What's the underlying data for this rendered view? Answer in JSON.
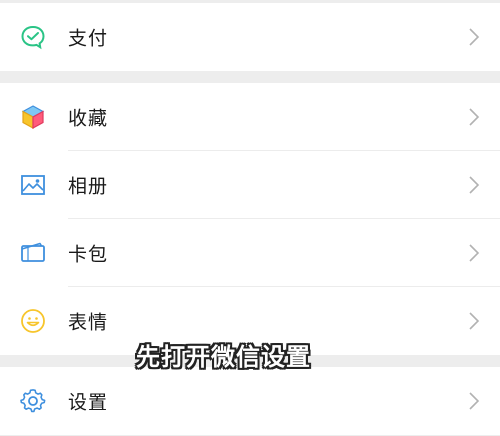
{
  "menu": {
    "pay": {
      "label": "支付",
      "icon": "pay-icon"
    },
    "favorites": {
      "label": "收藏",
      "icon": "favorites-cube-icon"
    },
    "album": {
      "label": "相册",
      "icon": "album-image-icon"
    },
    "cards": {
      "label": "卡包",
      "icon": "card-wallet-icon"
    },
    "stickers": {
      "label": "表情",
      "icon": "smiley-face-icon"
    },
    "settings": {
      "label": "设置",
      "icon": "gear-icon"
    }
  },
  "caption": "先打开微信设置",
  "colors": {
    "pay_green": "#2ac486",
    "blue": "#3e8fde",
    "sticker_yellow": "#f7c52b",
    "background": "#ededed"
  }
}
